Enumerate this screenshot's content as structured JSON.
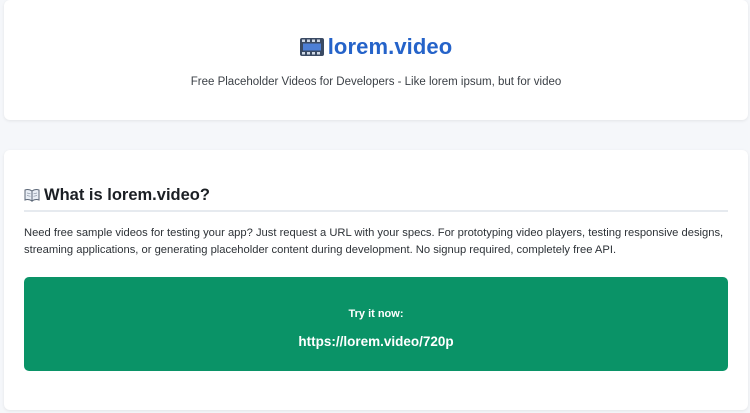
{
  "header": {
    "brand_icon": "film-icon",
    "title": "lorem.video",
    "tagline": "Free Placeholder Videos for Developers - Like lorem ipsum, but for video",
    "accent_color": "#2563c9"
  },
  "about": {
    "icon": "book-icon",
    "heading": "What is lorem.video?",
    "description": "Need free sample videos for testing your app? Just request a URL with your specs. For prototyping video players, testing responsive designs, streaming applications, or generating placeholder content during development. No signup required, completely free API."
  },
  "try_it": {
    "label": "Try it now:",
    "url": "https://lorem.video/720p",
    "background_color": "#0a9367"
  }
}
